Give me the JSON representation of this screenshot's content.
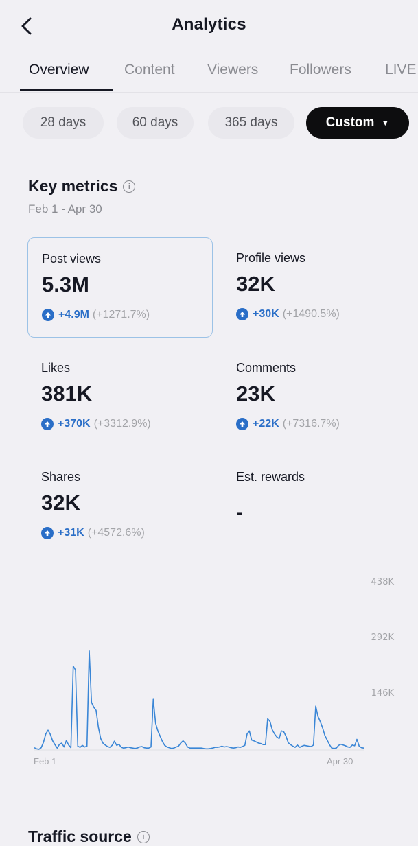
{
  "header": {
    "title": "Analytics"
  },
  "tabs": [
    {
      "label": "Overview",
      "active": true
    },
    {
      "label": "Content"
    },
    {
      "label": "Viewers"
    },
    {
      "label": "Followers"
    },
    {
      "label": "LIVE"
    }
  ],
  "ranges": {
    "options": [
      "28 days",
      "60 days",
      "365 days",
      "Custom"
    ],
    "selected": "Custom"
  },
  "key_metrics": {
    "title": "Key metrics",
    "date_range": "Feb 1 - Apr 30",
    "items": [
      {
        "label": "Post views",
        "value": "5.3M",
        "change": "+4.9M",
        "pct": "(+1271.7%)",
        "selected": true
      },
      {
        "label": "Profile views",
        "value": "32K",
        "change": "+30K",
        "pct": "(+1490.5%)"
      },
      {
        "label": "Likes",
        "value": "381K",
        "change": "+370K",
        "pct": "(+3312.9%)"
      },
      {
        "label": "Comments",
        "value": "23K",
        "change": "+22K",
        "pct": "(+7316.7%)"
      },
      {
        "label": "Shares",
        "value": "32K",
        "change": "+31K",
        "pct": "(+4572.6%)"
      },
      {
        "label": "Est. rewards",
        "value": "-"
      }
    ]
  },
  "chart_data": {
    "type": "line",
    "title": "",
    "xlabel": "",
    "ylabel": "",
    "x_tick_labels": [
      "Feb 1",
      "Apr 30"
    ],
    "y_tick_labels": [
      "438K",
      "292K",
      "146K"
    ],
    "y_ticks": [
      438,
      292,
      146
    ],
    "ylim": [
      0,
      438
    ],
    "y_unit": "K",
    "series_color": "#3a86d6",
    "series": [
      {
        "name": "",
        "values": [
          6,
          3,
          2,
          6,
          20,
          42,
          52,
          41,
          24,
          14,
          5,
          15,
          18,
          8,
          25,
          13,
          6,
          220,
          210,
          10,
          7,
          12,
          8,
          10,
          260,
          125,
          112,
          104,
          60,
          30,
          18,
          13,
          9,
          7,
          12,
          23,
          12,
          15,
          7,
          5,
          6,
          8,
          6,
          5,
          4,
          5,
          8,
          9,
          6,
          5,
          5,
          8,
          133,
          70,
          50,
          36,
          22,
          12,
          8,
          6,
          4,
          5,
          8,
          10,
          18,
          24,
          18,
          8,
          5,
          5,
          5,
          5,
          5,
          5,
          4,
          3,
          3,
          4,
          5,
          7,
          7,
          8,
          10,
          8,
          9,
          8,
          6,
          5,
          6,
          8,
          7,
          9,
          12,
          42,
          50,
          26,
          24,
          21,
          18,
          17,
          14,
          14,
          82,
          75,
          53,
          42,
          34,
          30,
          50,
          48,
          36,
          19,
          14,
          10,
          7,
          13,
          7,
          10,
          12,
          11,
          10,
          9,
          13,
          115,
          88,
          74,
          58,
          38,
          26,
          14,
          5,
          4,
          5,
          12,
          15,
          13,
          11,
          8,
          7,
          13,
          11,
          28,
          10,
          6,
          5
        ]
      }
    ]
  },
  "traffic": {
    "title": "Traffic source"
  }
}
